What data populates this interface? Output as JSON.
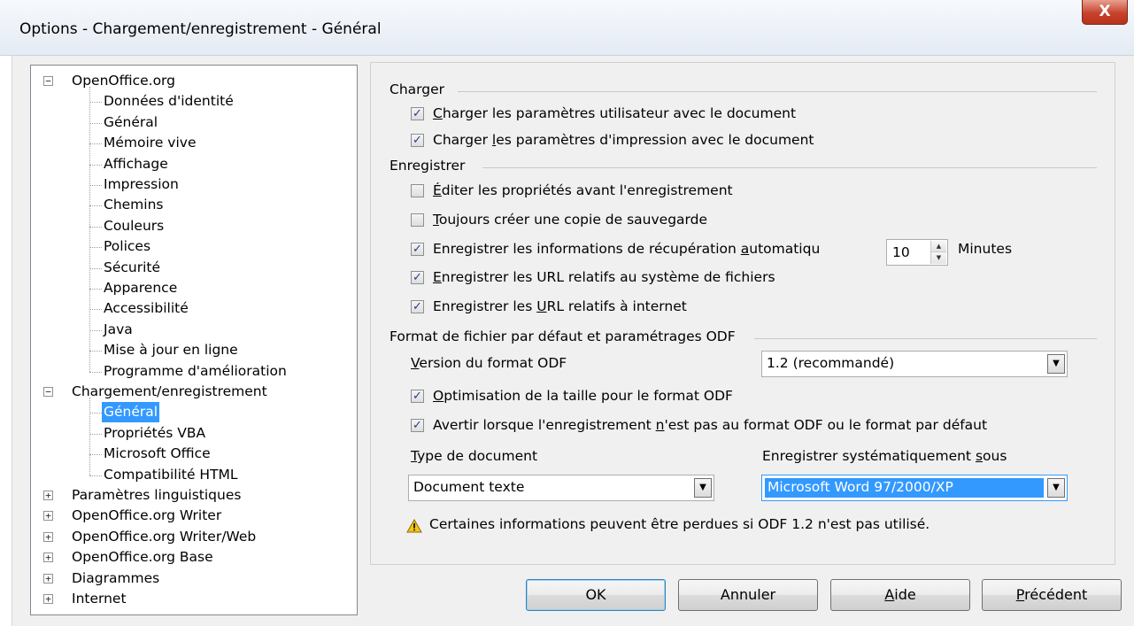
{
  "window": {
    "title": "Options - Chargement/enregistrement - Général",
    "close_label": "X"
  },
  "tree": {
    "items": [
      {
        "label": "OpenOffice.org",
        "toggle": "−",
        "level": 0
      },
      {
        "label": "Données d'identité",
        "level": 1
      },
      {
        "label": "Général",
        "level": 1
      },
      {
        "label": "Mémoire vive",
        "level": 1
      },
      {
        "label": "Affichage",
        "level": 1
      },
      {
        "label": "Impression",
        "level": 1
      },
      {
        "label": "Chemins",
        "level": 1
      },
      {
        "label": "Couleurs",
        "level": 1
      },
      {
        "label": "Polices",
        "level": 1
      },
      {
        "label": "Sécurité",
        "level": 1
      },
      {
        "label": "Apparence",
        "level": 1
      },
      {
        "label": "Accessibilité",
        "level": 1
      },
      {
        "label": "Java",
        "level": 1
      },
      {
        "label": "Mise à jour en ligne",
        "level": 1
      },
      {
        "label": "Programme d'amélioration",
        "level": 1
      },
      {
        "label": "Chargement/enregistrement",
        "toggle": "−",
        "level": 0
      },
      {
        "label": "Général",
        "level": 1,
        "selected": true
      },
      {
        "label": "Propriétés VBA",
        "level": 1
      },
      {
        "label": "Microsoft Office",
        "level": 1
      },
      {
        "label": "Compatibilité HTML",
        "level": 1
      },
      {
        "label": "Paramètres linguistiques",
        "toggle": "+",
        "level": 0
      },
      {
        "label": "OpenOffice.org Writer",
        "toggle": "+",
        "level": 0
      },
      {
        "label": "OpenOffice.org Writer/Web",
        "toggle": "+",
        "level": 0
      },
      {
        "label": "OpenOffice.org Base",
        "toggle": "+",
        "level": 0
      },
      {
        "label": "Diagrammes",
        "toggle": "+",
        "level": 0
      },
      {
        "label": "Internet",
        "toggle": "+",
        "level": 0
      }
    ]
  },
  "load": {
    "section_title": "Charger",
    "user_settings": {
      "pre": "",
      "accel": "C",
      "post": "harger les paramètres utilisateur avec le document",
      "checked": true
    },
    "printer_settings": {
      "pre": "Charger ",
      "accel": "l",
      "post": "es paramètres d'impression avec le document",
      "checked": true
    }
  },
  "save": {
    "section_title": "Enregistrer",
    "edit_properties": {
      "pre": "",
      "accel": "É",
      "post": "diter les propriétés avant l'enregistrement",
      "checked": false
    },
    "backup_copy": {
      "pre": "",
      "accel": "T",
      "post": "oujours créer une copie de sauvegarde",
      "checked": false
    },
    "autorecovery": {
      "pre": "Enregistrer les informations de récupération ",
      "accel": "a",
      "post": "utomatiqu",
      "checked": true
    },
    "autorecovery_minutes": "10",
    "minutes_label": "Minutes",
    "relative_fs": {
      "pre": "",
      "accel": "E",
      "post": "nregistrer les URL relatifs au système de fichiers",
      "checked": true
    },
    "relative_internet": {
      "pre": "Enregistrer les ",
      "accel": "U",
      "post": "RL relatifs à internet",
      "checked": true
    }
  },
  "odf": {
    "section_title": "Format de fichier par défaut et paramétrages ODF",
    "version_label": {
      "pre": "",
      "accel": "V",
      "post": "ersion du format ODF"
    },
    "version_value": "1.2 (recommandé)",
    "size_optimization": {
      "pre": "",
      "accel": "O",
      "post": "ptimisation de la taille pour le format ODF",
      "checked": true
    },
    "warn_non_odf": {
      "pre": "Avertir lorsque l'enregistrement ",
      "accel": "n",
      "post": "'est pas au format ODF ou le format par défaut",
      "checked": true
    },
    "doc_type_label": {
      "pre": "",
      "accel": "T",
      "post": "ype de document"
    },
    "doc_type_value": "Document texte",
    "always_save_as_label": {
      "pre": "Enregistrer systématiquement ",
      "accel": "s",
      "post": "ous"
    },
    "always_save_as_value": "Microsoft Word 97/2000/XP",
    "warning_text": "Certaines informations peuvent être perdues si ODF 1.2 n'est pas utilisé."
  },
  "buttons": {
    "ok": {
      "pre": "",
      "accel": "",
      "post": "OK"
    },
    "cancel": {
      "pre": "",
      "accel": "",
      "post": "Annuler"
    },
    "help": {
      "pre": "",
      "accel": "A",
      "post": "ide"
    },
    "back": {
      "pre": "",
      "accel": "P",
      "post": "récédent"
    }
  },
  "colors": {
    "selection": "#3399ff",
    "dialog_bg": "#f0f0f0",
    "close_button": "#c7432b",
    "warning_icon": "#f5c518"
  },
  "icons": {
    "warning": "warning-triangle-icon",
    "dropdown": "chevron-down-icon",
    "spin": "spin-arrows-icon"
  }
}
